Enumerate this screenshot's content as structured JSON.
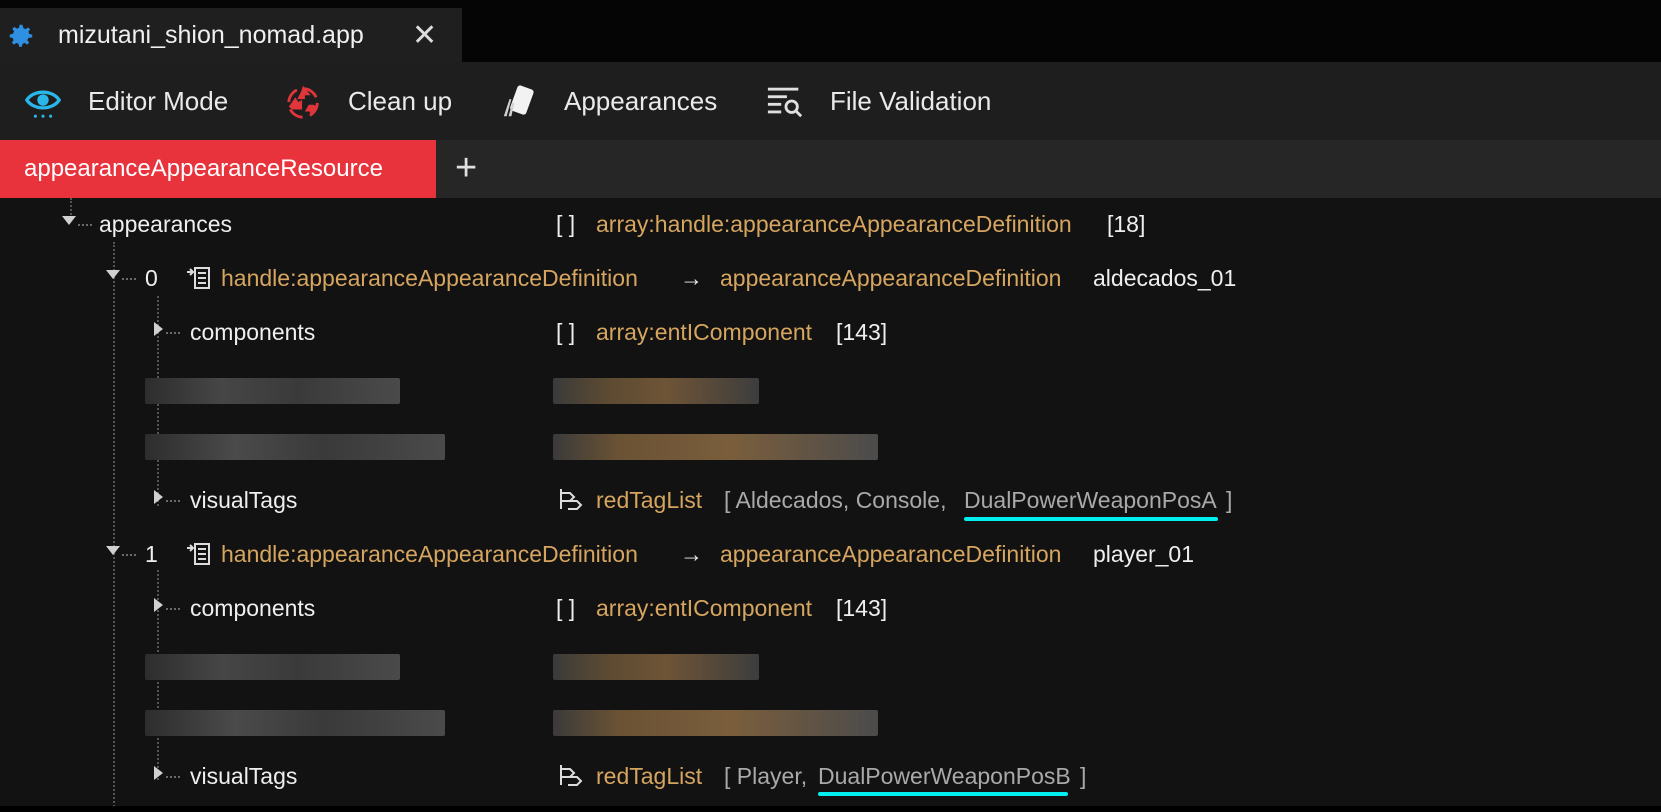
{
  "window": {
    "tab_title": "mizutani_shion_nomad.app",
    "close_glyph": "✕",
    "icon": "gear-icon"
  },
  "toolbar": {
    "items": [
      {
        "label": "Editor Mode",
        "icon": "eye-icon"
      },
      {
        "label": "Clean up",
        "icon": "recycle-icon"
      },
      {
        "label": "Appearances",
        "icon": "cards-icon"
      },
      {
        "label": "File Validation",
        "icon": "list-search-icon"
      }
    ]
  },
  "doc_tabs": {
    "active": "appearanceAppearanceResource",
    "add_glyph": "+"
  },
  "tree": {
    "appearances": {
      "name": "appearances",
      "brackets": "[ ]",
      "type": "array:handle:appearanceAppearanceDefinition",
      "count": "[18]"
    },
    "items": [
      {
        "index": "0",
        "handle_type": "handle:appearanceAppearanceDefinition",
        "arrow": "→",
        "target_type": "appearanceAppearanceDefinition",
        "target_name": "aldecados_01",
        "components": {
          "name": "components",
          "brackets": "[ ]",
          "type": "array:entIComponent",
          "count": "[143]"
        },
        "visualTags": {
          "name": "visualTags",
          "type": "redTagList",
          "open": "[ Aldecados, Console,",
          "highlighted": "DualPowerWeaponPosA",
          "close": "]"
        }
      },
      {
        "index": "1",
        "handle_type": "handle:appearanceAppearanceDefinition",
        "arrow": "→",
        "target_type": "appearanceAppearanceDefinition",
        "target_name": "player_01",
        "components": {
          "name": "components",
          "brackets": "[ ]",
          "type": "array:entIComponent",
          "count": "[143]"
        },
        "visualTags": {
          "name": "visualTags",
          "type": "redTagList",
          "open": "[ Player,",
          "highlighted": "DualPowerWeaponPosB",
          "close": "]"
        }
      }
    ]
  },
  "colors": {
    "accent_tab": "#e8323c",
    "highlight_underline": "#00f0f0",
    "type_text": "#d6a55f"
  }
}
